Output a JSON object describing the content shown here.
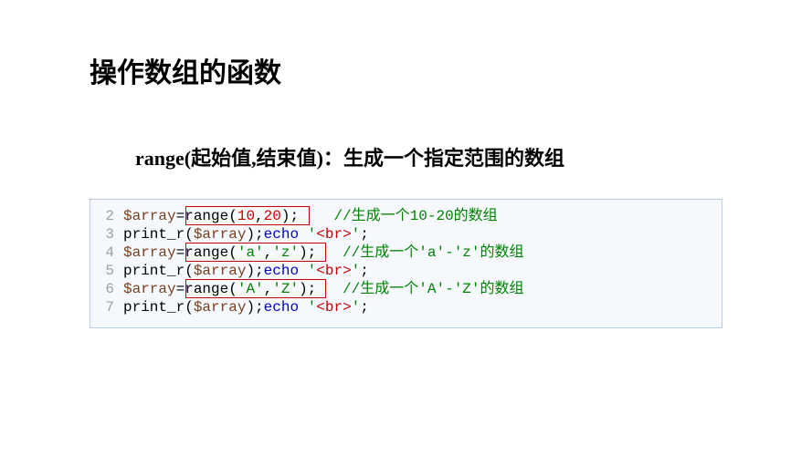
{
  "heading": "操作数组的函数",
  "subheading": {
    "fn": "range(起始值,结束值)",
    "sep": "：",
    "desc": "生成一个指定范围的数组"
  },
  "code": {
    "lines": [
      {
        "num": "2",
        "segs": [
          {
            "t": "$array",
            "c": "var"
          },
          {
            "t": "=",
            "c": "plain"
          },
          {
            "t": "range",
            "c": "fn-name"
          },
          {
            "t": "(",
            "c": "plain"
          },
          {
            "t": "10",
            "c": "num"
          },
          {
            "t": ",",
            "c": "plain"
          },
          {
            "t": "20",
            "c": "num"
          },
          {
            "t": ");",
            "c": "plain"
          },
          {
            "t": "    ",
            "c": "plain"
          },
          {
            "t": "//生成一个10-20的数组",
            "c": "comment"
          }
        ]
      },
      {
        "num": "3",
        "segs": [
          {
            "t": "print_r",
            "c": "fn-name"
          },
          {
            "t": "(",
            "c": "plain"
          },
          {
            "t": "$array",
            "c": "var"
          },
          {
            "t": ");",
            "c": "plain"
          },
          {
            "t": "echo",
            "c": "kw"
          },
          {
            "t": " ",
            "c": "plain"
          },
          {
            "t": "'",
            "c": "str"
          },
          {
            "t": "<br>",
            "c": "tag"
          },
          {
            "t": "'",
            "c": "str"
          },
          {
            "t": ";",
            "c": "plain"
          }
        ]
      },
      {
        "num": "4",
        "segs": [
          {
            "t": "$array",
            "c": "var"
          },
          {
            "t": "=",
            "c": "plain"
          },
          {
            "t": "range",
            "c": "fn-name"
          },
          {
            "t": "(",
            "c": "plain"
          },
          {
            "t": "'a'",
            "c": "str"
          },
          {
            "t": ",",
            "c": "plain"
          },
          {
            "t": "'z'",
            "c": "str"
          },
          {
            "t": ");",
            "c": "plain"
          },
          {
            "t": "   ",
            "c": "plain"
          },
          {
            "t": "//生成一个'a'-'z'的数组",
            "c": "comment"
          }
        ]
      },
      {
        "num": "5",
        "segs": [
          {
            "t": "print_r",
            "c": "fn-name"
          },
          {
            "t": "(",
            "c": "plain"
          },
          {
            "t": "$array",
            "c": "var"
          },
          {
            "t": ");",
            "c": "plain"
          },
          {
            "t": "echo",
            "c": "kw"
          },
          {
            "t": " ",
            "c": "plain"
          },
          {
            "t": "'",
            "c": "str"
          },
          {
            "t": "<br>",
            "c": "tag"
          },
          {
            "t": "'",
            "c": "str"
          },
          {
            "t": ";",
            "c": "plain"
          }
        ]
      },
      {
        "num": "6",
        "segs": [
          {
            "t": "$array",
            "c": "var"
          },
          {
            "t": "=",
            "c": "plain"
          },
          {
            "t": "range",
            "c": "fn-name"
          },
          {
            "t": "(",
            "c": "plain"
          },
          {
            "t": "'A'",
            "c": "str"
          },
          {
            "t": ",",
            "c": "plain"
          },
          {
            "t": "'Z'",
            "c": "str"
          },
          {
            "t": ");",
            "c": "plain"
          },
          {
            "t": "   ",
            "c": "plain"
          },
          {
            "t": "//生成一个'A'-'Z'的数组",
            "c": "comment"
          }
        ]
      },
      {
        "num": "7",
        "segs": [
          {
            "t": "print_r",
            "c": "fn-name"
          },
          {
            "t": "(",
            "c": "plain"
          },
          {
            "t": "$array",
            "c": "var"
          },
          {
            "t": ");",
            "c": "plain"
          },
          {
            "t": "echo",
            "c": "kw"
          },
          {
            "t": " ",
            "c": "plain"
          },
          {
            "t": "'",
            "c": "str"
          },
          {
            "t": "<br>",
            "c": "tag"
          },
          {
            "t": "'",
            "c": "str"
          },
          {
            "t": ";",
            "c": "plain"
          }
        ]
      }
    ]
  }
}
